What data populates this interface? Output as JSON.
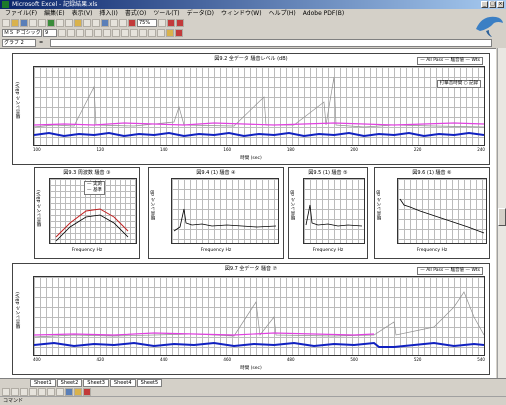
{
  "window": {
    "title": "Microsoft Excel - 記録結果.xls"
  },
  "menu": [
    "ファイル(F)",
    "編集(E)",
    "表示(V)",
    "挿入(I)",
    "書式(O)",
    "ツール(T)",
    "データ(D)",
    "ウィンドウ(W)",
    "ヘルプ(H)",
    "Adobe PDF(B)"
  ],
  "toolbar": {
    "zoom": "75%",
    "font": "ＭＳ Ｐゴシック",
    "size": "9"
  },
  "formula": {
    "namebox": "グラフ 2",
    "value": ""
  },
  "charts": {
    "top": {
      "title": "図9.2 全データ 騒音レベル (dB)",
      "ylabel": "騒音レベル dB(A)",
      "xlabel": "時間 (sec)",
      "legend": [
        "All Pass",
        "騒音値",
        "Wts"
      ],
      "xticks": [
        "100",
        "120",
        "140",
        "160",
        "180",
        "200",
        "220",
        "240"
      ],
      "note": "打撃音時間 ○ 記録"
    },
    "p1": {
      "title": "図9.3 周波数 騒音 ③",
      "ylabel": "騒音レベル dB(A)",
      "xlabel": "Frequency Hz",
      "legend": [
        "実測",
        "基準"
      ]
    },
    "p2": {
      "title": "図9.4 (1) 騒音 ④",
      "ylabel": "騒音レベル dB",
      "xlabel": "Frequency Hz"
    },
    "p3": {
      "title": "図9.5 (1) 騒音 ⑤",
      "ylabel": "騒音レベル dB",
      "xlabel": "Frequency Hz"
    },
    "p4": {
      "title": "図9.6 (1) 騒音 ⑥",
      "ylabel": "騒音レベル dB",
      "xlabel": "Frequency Hz"
    },
    "bottom": {
      "title": "図9.7 全データ 騒音 ⑦",
      "ylabel": "騒音レベル dB(A)",
      "xlabel": "時間 (sec)",
      "legend": [
        "All Pass",
        "騒音値",
        "Wts"
      ],
      "xticks": [
        "400",
        "420",
        "440",
        "460",
        "480",
        "500",
        "520",
        "540"
      ]
    }
  },
  "tabs": [
    "Sheet1",
    "Sheet2",
    "Sheet3",
    "Sheet4",
    "Sheet5"
  ],
  "status": "コマンド",
  "colors": {
    "pink": "#e040e0",
    "blue": "#1020c0",
    "gray": "#909090",
    "red": "#c02020"
  }
}
